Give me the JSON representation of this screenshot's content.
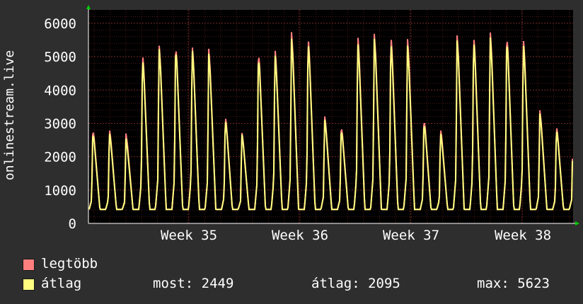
{
  "chart_data": {
    "type": "line",
    "ylabel": "onlinestream.live",
    "ylim": [
      0,
      6400
    ],
    "yticks": [
      0,
      1000,
      2000,
      3000,
      4000,
      5000,
      6000
    ],
    "xticks": [
      "Week 35",
      "Week 36",
      "Week 37",
      "Week 38"
    ],
    "grid": true,
    "series": [
      {
        "name": "legtöbb",
        "color": "#ff7f7f",
        "daily_peaks": [
          2850,
          2850,
          2700,
          5150,
          5400,
          5400,
          5400,
          5250,
          3250,
          2750,
          5200,
          5300,
          5750,
          5650,
          3250,
          2950,
          5700,
          5700,
          5700,
          5600,
          3150,
          2850,
          5650,
          5700,
          5800,
          5700,
          5600,
          3400,
          2950
        ]
      },
      {
        "name": "átlag",
        "color": "#ffff80",
        "daily_peaks": [
          2750,
          2750,
          2550,
          5000,
          5300,
          5300,
          5300,
          5100,
          3150,
          2700,
          5050,
          5150,
          5550,
          5500,
          3150,
          2850,
          5500,
          5550,
          5500,
          5400,
          3050,
          2750,
          5500,
          5550,
          5650,
          5550,
          5450,
          3300,
          2850
        ]
      }
    ]
  },
  "legend": {
    "max_label": "legtöbb",
    "avg_label": "átlag",
    "now_text": "most: 2449",
    "avg_text": "átlag: 2095",
    "max_text": "max: 5623"
  }
}
